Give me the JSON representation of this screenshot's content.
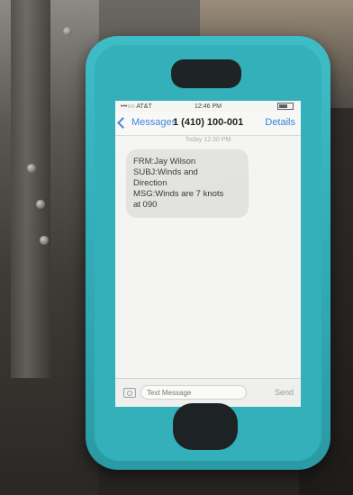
{
  "status_bar": {
    "carrier": "•••○○ AT&T",
    "time": "12:46 PM",
    "battery_icon": "battery-icon"
  },
  "nav": {
    "back_label": "Messages",
    "title": "1 (410) 100-001",
    "details_label": "Details"
  },
  "thread": {
    "date_line": "Today 12:30 PM",
    "message_lines": [
      "FRM:Jay Wilson",
      "SUBJ:Winds and",
      "Direction",
      "MSG:Winds are 7 knots",
      "at 090"
    ]
  },
  "compose": {
    "placeholder": "Text Message",
    "send_label": "Send",
    "camera_icon": "camera-icon"
  },
  "colors": {
    "case": "#3fbdc6",
    "link": "#2f7bd8"
  }
}
